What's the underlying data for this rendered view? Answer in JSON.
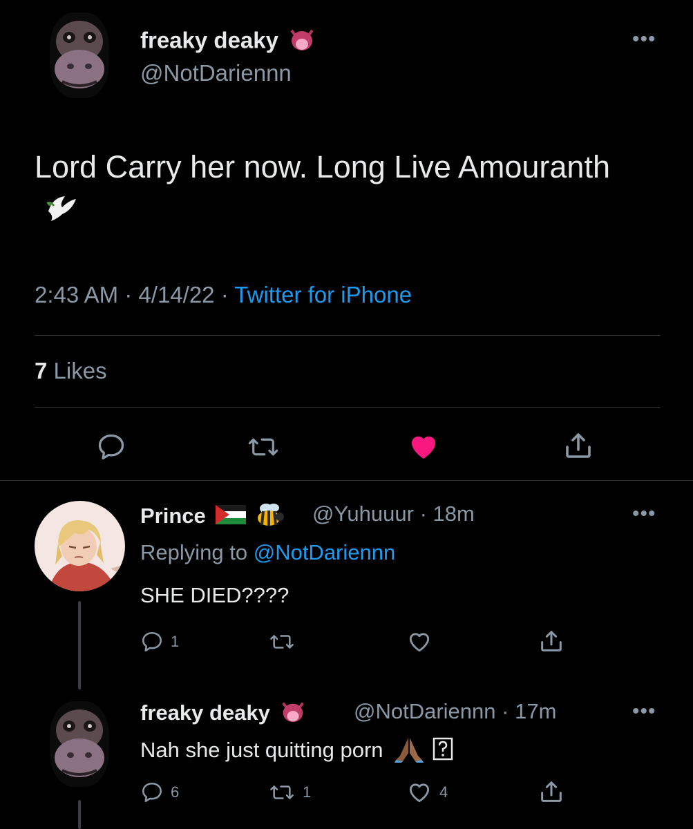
{
  "colors": {
    "background": "#000000",
    "text": "#e7e9ea",
    "muted": "#8b98a5",
    "link": "#1d9bf0",
    "like": "#f91880"
  },
  "main_tweet": {
    "author_name": "freaky deaky",
    "author_emoji": "tongue-face-emoji",
    "author_handle": "@NotDariennn",
    "text": "Lord Carry her now. Long Live Amouranth",
    "text_emoji": "dove-emoji",
    "time": "2:43 AM",
    "date": "4/14/22",
    "source": "Twitter for iPhone",
    "likes_count": "7",
    "likes_label": "Likes",
    "liked": true,
    "sep": "·"
  },
  "reply_1": {
    "author_name": "Prince",
    "author_emojis": [
      "palestine-flag-emoji",
      "bee-emoji"
    ],
    "author_handle": "@Yuhuuur",
    "time": "18m",
    "replying_label": "Replying to",
    "replying_to": "@NotDariennn",
    "text": "SHE DIED????",
    "reply_count": "1",
    "retweet_count": "",
    "like_count": ""
  },
  "reply_2": {
    "author_name": "freaky deaky",
    "author_emoji": "tongue-face-emoji",
    "author_handle": "@NotDariennn",
    "time": "17m",
    "text": "Nah she just quitting porn",
    "text_emojis": [
      "praying-hands-emoji",
      "unknown-glyph-box"
    ],
    "reply_count": "6",
    "retweet_count": "1",
    "like_count": "4"
  },
  "dot_sep": "·",
  "more_label": "•••"
}
